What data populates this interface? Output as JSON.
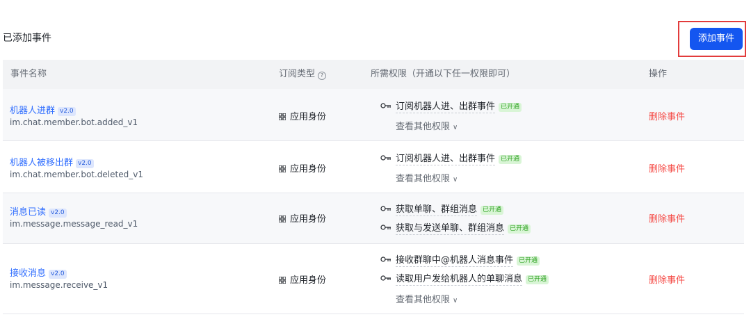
{
  "header": {
    "section_title": "已添加事件",
    "add_button": "添加事件"
  },
  "table": {
    "columns": [
      "事件名称",
      "订阅类型",
      "所需权限（开通以下任一权限即可）",
      "操作"
    ],
    "help_icon": "help-circle-icon",
    "rows": [
      {
        "name": "机器人进群",
        "version": "v2.0",
        "code": "im.chat.member.bot.added_v1",
        "sub_type": "应用身份",
        "permissions": [
          {
            "text": "订阅机器人进、出群事件",
            "status": "已开通"
          }
        ],
        "more": "查看其他权限",
        "action": "删除事件"
      },
      {
        "name": "机器人被移出群",
        "version": "v2.0",
        "code": "im.chat.member.bot.deleted_v1",
        "sub_type": "应用身份",
        "permissions": [
          {
            "text": "订阅机器人进、出群事件",
            "status": "已开通"
          }
        ],
        "more": "查看其他权限",
        "action": "删除事件"
      },
      {
        "name": "消息已读",
        "version": "v2.0",
        "code": "im.message.message_read_v1",
        "sub_type": "应用身份",
        "permissions": [
          {
            "text": "获取单聊、群组消息",
            "status": "已开通"
          },
          {
            "text": "获取与发送单聊、群组消息",
            "status": "已开通"
          }
        ],
        "action": "删除事件"
      },
      {
        "name": "接收消息",
        "version": "v2.0",
        "code": "im.message.receive_v1",
        "sub_type": "应用身份",
        "permissions": [
          {
            "text": "接收群聊中@机器人消息事件",
            "status": "已开通"
          },
          {
            "text": "读取用户发给机器人的单聊消息",
            "status": "已开通"
          }
        ],
        "more": "查看其他权限",
        "action": "删除事件"
      }
    ]
  },
  "colors": {
    "primary": "#1456f0",
    "link": "#3370ff",
    "danger": "#f54a45",
    "success": "#2ea121",
    "highlight_border": "#e23b3b"
  }
}
